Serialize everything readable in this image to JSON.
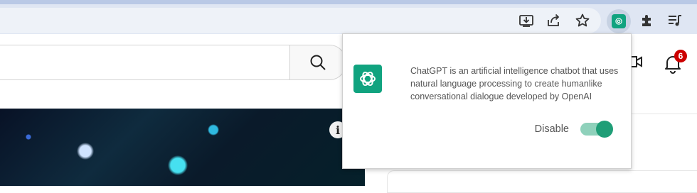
{
  "toolbar": {
    "icons": [
      "install-app-icon",
      "share-icon",
      "bookmark-star-icon",
      "chatgpt-extension-icon",
      "extensions-puzzle-icon",
      "reading-list-icon"
    ]
  },
  "youtube": {
    "search_placeholder": "",
    "notification_count": "6",
    "info_badge": "i"
  },
  "popup": {
    "description": "ChatGPT is an artificial intelligence chatbot that uses natural language processing to create humanlike conversational dialogue developed by OpenAI",
    "toggle_label": "Disable",
    "toggle_state": "on"
  },
  "colors": {
    "accent_green": "#10a37f",
    "toggle_track": "#8fd1bb",
    "toggle_knob": "#1f9e77",
    "notification_red": "#cc0000"
  }
}
